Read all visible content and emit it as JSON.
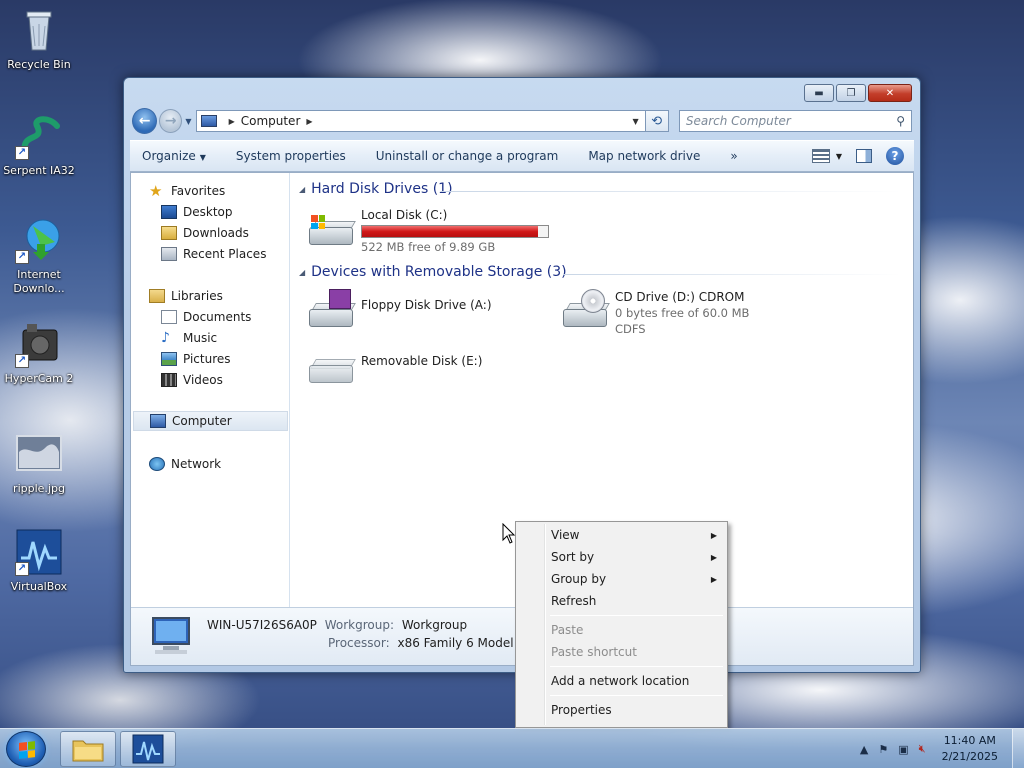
{
  "desktop": {
    "icons": [
      {
        "label": "Recycle Bin",
        "icon": "recycle-bin-icon"
      },
      {
        "label": "Serpent IA32",
        "icon": "serpent-icon"
      },
      {
        "label": "Internet\nDownlo...",
        "icon": "internet-download-icon"
      },
      {
        "label": "HyperCam 2",
        "icon": "hypercam-icon"
      },
      {
        "label": "ripple.jpg",
        "icon": "image-file-icon"
      },
      {
        "label": "VirtualBox",
        "icon": "virtualbox-icon"
      }
    ]
  },
  "window": {
    "caption_buttons": {
      "minimize": "▬",
      "maximize": "❐",
      "close": "✕"
    },
    "address": {
      "segment": "Computer"
    },
    "search": {
      "placeholder": "Search Computer"
    },
    "commands": {
      "organize": "Organize",
      "system_properties": "System properties",
      "uninstall": "Uninstall or change a program",
      "map_drive": "Map network drive",
      "more": "»"
    },
    "nav": {
      "favorites": "Favorites",
      "desktop": "Desktop",
      "downloads": "Downloads",
      "recent": "Recent Places",
      "libraries": "Libraries",
      "documents": "Documents",
      "music": "Music",
      "pictures": "Pictures",
      "videos": "Videos",
      "computer": "Computer",
      "network": "Network"
    },
    "groups": {
      "hdd": "Hard Disk Drives (1)",
      "removable": "Devices with Removable Storage (3)"
    },
    "drives": {
      "c": {
        "name": "Local Disk (C:)",
        "free": "522 MB free of 9.89 GB",
        "used_fraction": 0.948
      },
      "a": {
        "name": "Floppy Disk Drive (A:)"
      },
      "d": {
        "name": "CD Drive (D:) CDROM",
        "free": "0 bytes free of 60.0 MB",
        "fs": "CDFS"
      },
      "e": {
        "name": "Removable Disk (E:)"
      }
    },
    "details": {
      "computer_name": "WIN-U57I26S6A0P",
      "workgroup_label": "Workgroup:",
      "workgroup": "Workgroup",
      "processor_label": "Processor:",
      "processor": "x86 Family 6 Model 7 St..."
    }
  },
  "context_menu": {
    "view": "View",
    "sort_by": "Sort by",
    "group_by": "Group by",
    "refresh": "Refresh",
    "paste": "Paste",
    "paste_shortcut": "Paste shortcut",
    "add_network_location": "Add a network location",
    "properties": "Properties"
  },
  "taskbar": {
    "time": "11:40 AM",
    "date": "2/21/2025",
    "show_hidden": "▲"
  },
  "colors": {
    "capacity_fill": "#d01818",
    "group_header": "#1e3287"
  }
}
